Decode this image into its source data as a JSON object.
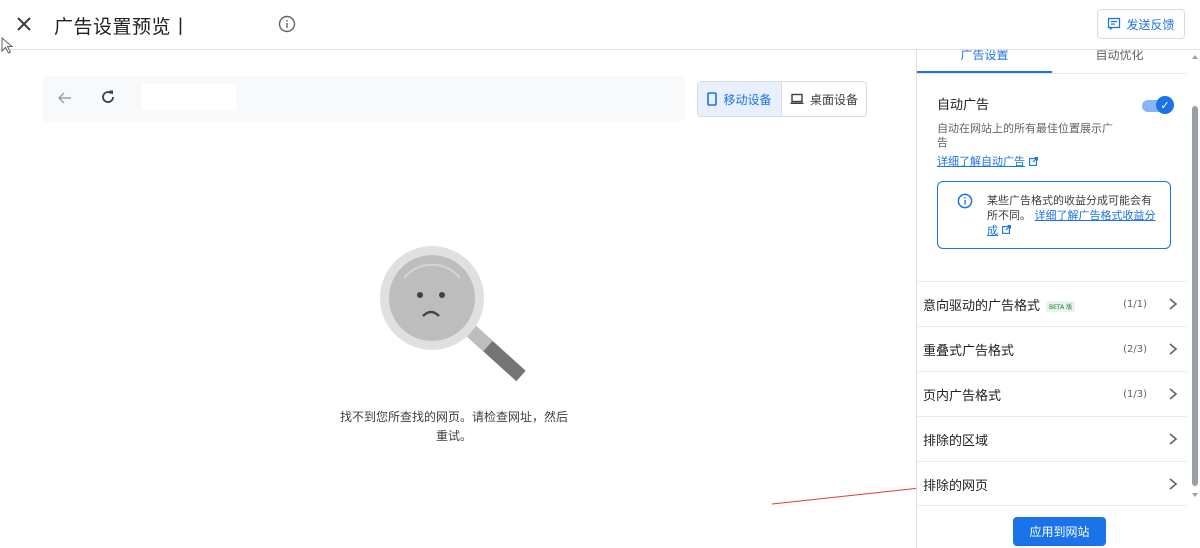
{
  "header": {
    "title": "广告设置预览丨",
    "feedback_label": "发送反馈"
  },
  "preview": {
    "device_mobile_label": "移动设备",
    "device_desktop_label": "桌面设备",
    "selected_device": "移动设备",
    "not_found_line1": "找不到您所查找的网页。请检查网址，然后",
    "not_found_line2": "重试。"
  },
  "panel": {
    "tabs": [
      {
        "label": "广告设置",
        "active": true
      },
      {
        "label": "自动优化",
        "active": false
      }
    ],
    "auto_ads": {
      "title": "自动广告",
      "enabled": true,
      "description": "自动在网站上的所有最佳位置展示广告",
      "learn_more": "详细了解自动广告"
    },
    "info_box": {
      "text": "某些广告格式的收益分成可能会有所不同。",
      "link": "详细了解广告格式收益分成"
    },
    "menu_items": [
      {
        "label": "意向驱动的广告格式",
        "badge": "BETA 版",
        "count": "(1/1)"
      },
      {
        "label": "重叠式广告格式",
        "count": "(2/3)"
      },
      {
        "label": "页内广告格式",
        "count": "(1/3)"
      },
      {
        "label": "排除的区域",
        "count": ""
      },
      {
        "label": "排除的网页",
        "count": ""
      }
    ],
    "apply_label": "应用到网站"
  },
  "colors": {
    "accent": "#1a73e8",
    "annotation_arrow": "#e53935"
  },
  "icons": [
    "close-icon",
    "info-icon",
    "feedback-icon",
    "back-arrow-icon",
    "reload-icon",
    "phone-icon",
    "laptop-icon",
    "sad-magnifier-icon",
    "external-link-icon",
    "chevron-right-icon",
    "check-icon"
  ]
}
